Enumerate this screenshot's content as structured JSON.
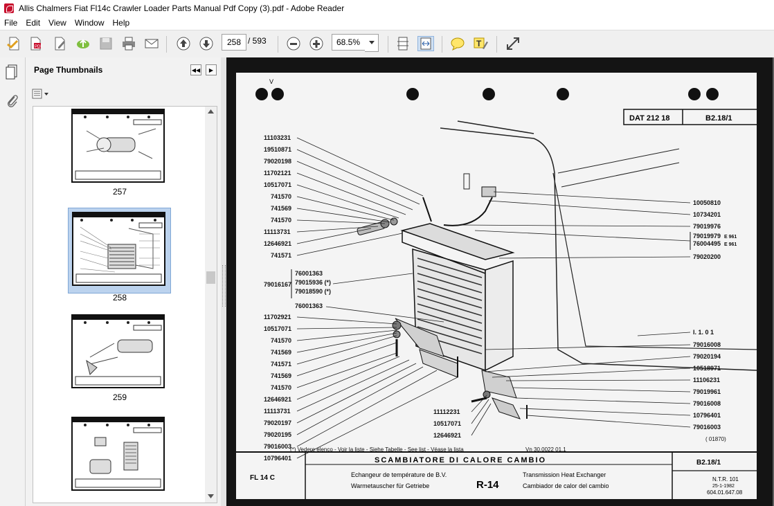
{
  "window": {
    "title": "Allis Chalmers Fiat Fl14c Crawler Loader Parts Manual Pdf   Copy (3).pdf - Adobe Reader"
  },
  "menu": [
    "File",
    "Edit",
    "View",
    "Window",
    "Help"
  ],
  "toolbar": {
    "current_page": "258",
    "page_total": "/ 593",
    "zoom": "68.5%"
  },
  "panel": {
    "title": "Page Thumbnails"
  },
  "thumbnails": [
    {
      "label": "257",
      "selected": false
    },
    {
      "label": "258",
      "selected": true
    },
    {
      "label": "259",
      "selected": false
    },
    {
      "label": "",
      "selected": false
    }
  ],
  "icons": {
    "app": "adobe-reader-icon",
    "tools": [
      "create-pdf-icon",
      "export-icon",
      "edit-icon",
      "upload-icon",
      "save-icon",
      "print-icon",
      "email-icon",
      "page-up-icon",
      "page-down-icon",
      "zoom-out-icon",
      "zoom-in-icon",
      "zoom-dropdown-icon",
      "fit-page-icon",
      "fit-width-icon",
      "comment-icon",
      "highlight-icon",
      "fullscreen-icon"
    ]
  },
  "document": {
    "code_box": "DAT  212  18",
    "ref_box": "B2.18/1",
    "mark_v": "V",
    "left_parts": [
      "11103231",
      "19510871",
      "79020198",
      "11702121",
      "10517071",
      "741570",
      "741569",
      "741570",
      "11113731",
      "12646921",
      "741571"
    ],
    "group_main": "79016167",
    "group_items": [
      "76001363",
      "79015936 (*)",
      "79018590 (*)",
      "76001363"
    ],
    "left_parts_2": [
      "11702921",
      "10517071",
      "741570",
      "741569",
      "741571",
      "741569",
      "741570",
      "12646921",
      "11113731",
      "79020197",
      "79020195",
      "79016003",
      "10796401"
    ],
    "right_parts": [
      "10050810",
      "10734201",
      "79019976",
      "79019979",
      "76004495",
      "79020200"
    ],
    "right_notes": [
      "E 961",
      "E 961"
    ],
    "right_parts_2": [
      "I. 1. 0 1",
      "79016008",
      "79020194",
      "10518971",
      "11106231",
      "79019961",
      "79016008",
      "10796401",
      "79016003"
    ],
    "bottom_parts": [
      "11112231",
      "10517071",
      "12646921"
    ],
    "footnote": "(*) Vedere elenco - Voir la liste - Siehe Tabelle - See list - Véase la lista",
    "version": "Vn 30.0022 01.1",
    "page_code": "( 01870)",
    "tb_title": "SCAMBIATORE   DI   CALORE   CAMBIO",
    "tb_model": "FL 14 C",
    "tb_fr": "Echangeur de température de B.V.",
    "tb_de": "Warmetauscher für Getriebe",
    "tb_fig": "R-14",
    "tb_en": "Transmission Heat Exchanger",
    "tb_es": "Cambiador de calor del cambio",
    "tb_ref": "B2.18/1",
    "tb_ntr": "N.T.R. 101",
    "tb_date": "25-1-1982",
    "tb_num": "604.01.647.08"
  }
}
